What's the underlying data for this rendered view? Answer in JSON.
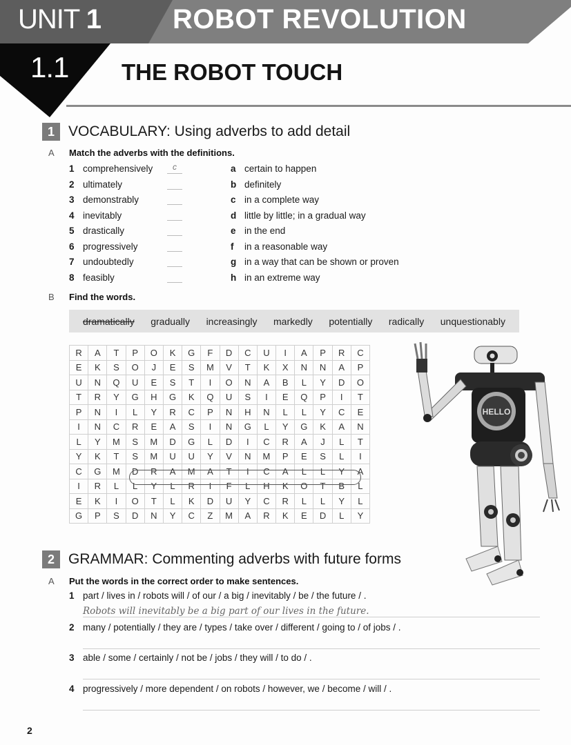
{
  "header": {
    "unit_label": "UNIT",
    "unit_number": "1",
    "unit_title": "ROBOT REVOLUTION",
    "lesson_number": "1.1",
    "lesson_title": "THE ROBOT TOUCH"
  },
  "section1": {
    "number": "1",
    "title": "VOCABULARY: Using adverbs to add detail",
    "partA": {
      "letter": "A",
      "instruction": "Match the adverbs with the definitions.",
      "adverbs": [
        {
          "n": "1",
          "word": "comprehensively",
          "answer": "c"
        },
        {
          "n": "2",
          "word": "ultimately",
          "answer": ""
        },
        {
          "n": "3",
          "word": "demonstrably",
          "answer": ""
        },
        {
          "n": "4",
          "word": "inevitably",
          "answer": ""
        },
        {
          "n": "5",
          "word": "drastically",
          "answer": ""
        },
        {
          "n": "6",
          "word": "progressively",
          "answer": ""
        },
        {
          "n": "7",
          "word": "undoubtedly",
          "answer": ""
        },
        {
          "n": "8",
          "word": "feasibly",
          "answer": ""
        }
      ],
      "definitions": [
        {
          "l": "a",
          "text": "certain to happen"
        },
        {
          "l": "b",
          "text": "definitely"
        },
        {
          "l": "c",
          "text": "in a complete way"
        },
        {
          "l": "d",
          "text": "little by little; in a gradual way"
        },
        {
          "l": "e",
          "text": "in the end"
        },
        {
          "l": "f",
          "text": "in a reasonable way"
        },
        {
          "l": "g",
          "text": "in a way that can be shown or proven"
        },
        {
          "l": "h",
          "text": "in an extreme way"
        }
      ]
    },
    "partB": {
      "letter": "B",
      "instruction": "Find the words.",
      "words": [
        "dramatically",
        "gradually",
        "increasingly",
        "markedly",
        "potentially",
        "radically",
        "unquestionably"
      ],
      "found_words": [
        "dramatically"
      ],
      "grid": [
        [
          "R",
          "A",
          "T",
          "P",
          "O",
          "K",
          "G",
          "F",
          "D",
          "C",
          "U",
          "I",
          "A",
          "P",
          "R",
          "C"
        ],
        [
          "E",
          "K",
          "S",
          "O",
          "J",
          "E",
          "S",
          "M",
          "V",
          "T",
          "K",
          "X",
          "N",
          "N",
          "A",
          "P"
        ],
        [
          "U",
          "N",
          "Q",
          "U",
          "E",
          "S",
          "T",
          "I",
          "O",
          "N",
          "A",
          "B",
          "L",
          "Y",
          "D",
          "O"
        ],
        [
          "T",
          "R",
          "Y",
          "G",
          "H",
          "G",
          "K",
          "Q",
          "U",
          "S",
          "I",
          "E",
          "Q",
          "P",
          "I",
          "T"
        ],
        [
          "P",
          "N",
          "I",
          "L",
          "Y",
          "R",
          "C",
          "P",
          "N",
          "H",
          "N",
          "L",
          "L",
          "Y",
          "C",
          "E"
        ],
        [
          "I",
          "N",
          "C",
          "R",
          "E",
          "A",
          "S",
          "I",
          "N",
          "G",
          "L",
          "Y",
          "G",
          "K",
          "A",
          "N"
        ],
        [
          "L",
          "Y",
          "M",
          "S",
          "M",
          "D",
          "G",
          "L",
          "D",
          "I",
          "C",
          "R",
          "A",
          "J",
          "L",
          "T"
        ],
        [
          "Y",
          "K",
          "T",
          "S",
          "M",
          "U",
          "U",
          "Y",
          "V",
          "N",
          "M",
          "P",
          "E",
          "S",
          "L",
          "I"
        ],
        [
          "C",
          "G",
          "M",
          "D",
          "R",
          "A",
          "M",
          "A",
          "T",
          "I",
          "C",
          "A",
          "L",
          "L",
          "Y",
          "A"
        ],
        [
          "I",
          "R",
          "L",
          "L",
          "Y",
          "L",
          "R",
          "I",
          "F",
          "L",
          "H",
          "K",
          "O",
          "T",
          "B",
          "L"
        ],
        [
          "E",
          "K",
          "I",
          "O",
          "T",
          "L",
          "K",
          "D",
          "U",
          "Y",
          "C",
          "R",
          "L",
          "L",
          "Y",
          "L"
        ],
        [
          "G",
          "P",
          "S",
          "D",
          "N",
          "Y",
          "C",
          "Z",
          "M",
          "A",
          "R",
          "K",
          "E",
          "D",
          "L",
          "Y"
        ]
      ]
    },
    "illustration": {
      "icon": "robot-illustration",
      "chest_text": "HELLO"
    }
  },
  "section2": {
    "number": "2",
    "title": "GRAMMAR: Commenting adverbs with future forms",
    "partA": {
      "letter": "A",
      "instruction": "Put the words in the correct order to make sentences.",
      "items": [
        {
          "n": "1",
          "prompt": "part / lives in / robots will / of our / a big / inevitably / be / the future / .",
          "answer": "Robots will inevitably be a big part of our lives in the future."
        },
        {
          "n": "2",
          "prompt": "many / potentially / they are / types / take over / different / going to / of jobs / .",
          "answer": ""
        },
        {
          "n": "3",
          "prompt": "able / some / certainly / not be / jobs / they will / to do / .",
          "answer": ""
        },
        {
          "n": "4",
          "prompt": "progressively / more dependent / on robots / however, we / become / will / .",
          "answer": ""
        }
      ]
    }
  },
  "footer": {
    "page_number": "2"
  }
}
